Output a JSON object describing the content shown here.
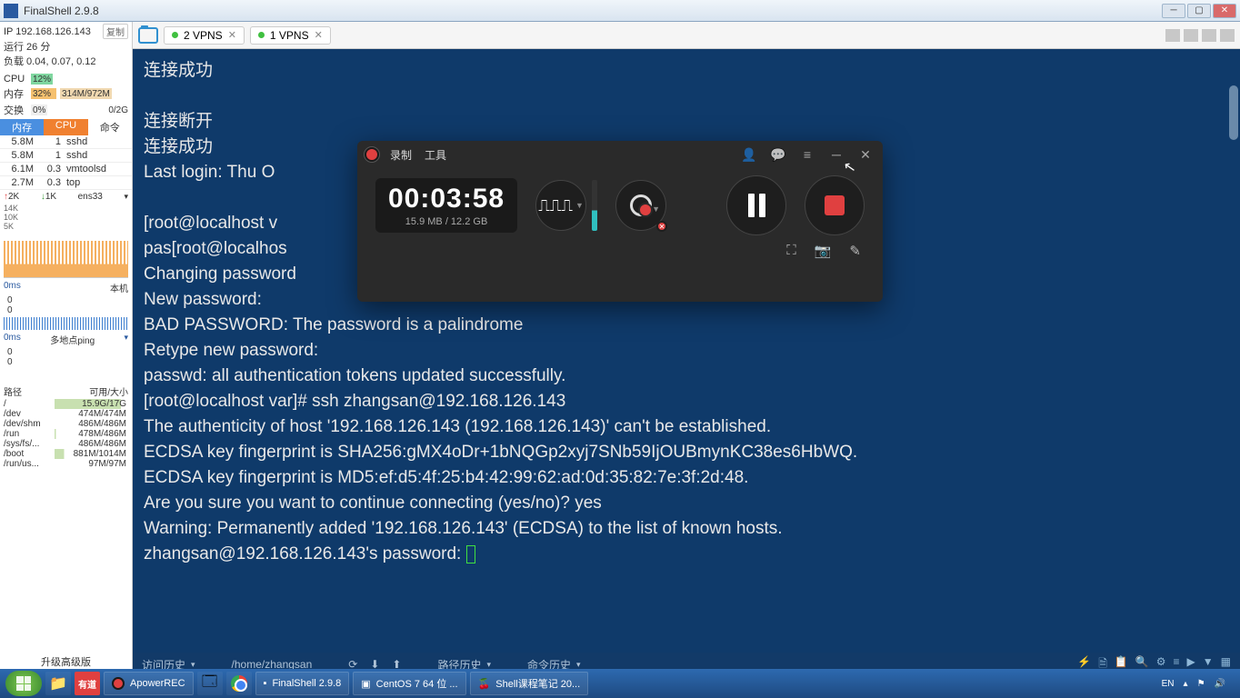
{
  "title": "FinalShell 2.9.8",
  "sidebar": {
    "ip": "IP 192.168.126.143",
    "copy": "复制",
    "uptime": "运行 26 分",
    "load": "负载 0.04, 0.07, 0.12",
    "cpu_lbl": "CPU",
    "cpu_pct": "12%",
    "mem_lbl": "内存",
    "mem_pct": "32%",
    "mem_txt": "314M/972M",
    "swap_lbl": "交换",
    "swap_pct": "0%",
    "swap_txt": "0/2G",
    "proc_hdr": {
      "a": "内存",
      "b": "CPU",
      "c": "命令"
    },
    "procs": [
      {
        "m": "5.8M",
        "c": "1",
        "n": "sshd"
      },
      {
        "m": "5.8M",
        "c": "1",
        "n": "sshd"
      },
      {
        "m": "6.1M",
        "c": "0.3",
        "n": "vmtoolsd"
      },
      {
        "m": "2.7M",
        "c": "0.3",
        "n": "top"
      }
    ],
    "net": {
      "up": "2K",
      "dn": "1K",
      "if": "ens33",
      "y1": "14K",
      "y2": "10K",
      "y3": "5K"
    },
    "lat1": {
      "l": "0ms",
      "r": "本机"
    },
    "lat2": {
      "l": "0ms",
      "r": "多地点ping"
    },
    "zeros": "0",
    "disk_hdr": {
      "a": "路径",
      "b": "可用/大小"
    },
    "disks": [
      {
        "p": "/",
        "s": "15.9G/17G",
        "u": 90
      },
      {
        "p": "/dev",
        "s": "474M/474M",
        "u": 0
      },
      {
        "p": "/dev/shm",
        "s": "486M/486M",
        "u": 0
      },
      {
        "p": "/run",
        "s": "478M/486M",
        "u": 2
      },
      {
        "p": "/sys/fs/...",
        "s": "486M/486M",
        "u": 0
      },
      {
        "p": "/boot",
        "s": "881M/1014M",
        "u": 13
      },
      {
        "p": "/run/us...",
        "s": "97M/97M",
        "u": 0
      }
    ],
    "upgrade": "升级高级版"
  },
  "tabs": [
    {
      "label": "2 VPNS"
    },
    {
      "label": "1 VPNS"
    }
  ],
  "terminal": [
    "连接成功",
    "",
    "连接断开",
    "连接成功",
    "Last login: Thu O",
    "",
    "[root@localhost v",
    "pas[root@localhos",
    "Changing password",
    "New password:",
    "BAD PASSWORD: The password is a palindrome",
    "Retype new password:",
    "passwd: all authentication tokens updated successfully.",
    "[root@localhost var]# ssh zhangsan@192.168.126.143",
    "The authenticity of host '192.168.126.143 (192.168.126.143)' can't be established.",
    "ECDSA key fingerprint is SHA256:gMX4oDr+1bNQGp2xyj7SNb59IjOUBmynKC38es6HbWQ.",
    "ECDSA key fingerprint is MD5:ef:d5:4f:25:b4:42:99:62:ad:0d:35:82:7e:3f:2d:48.",
    "Are you sure you want to continue connecting (yes/no)? yes",
    "Warning: Permanently added '192.168.126.143' (ECDSA) to the list of known hosts.",
    "zhangsan@192.168.126.143's password: "
  ],
  "bottom": {
    "hist": "访问历史",
    "path": "/home/zhangsan",
    "pathhist": "路径历史",
    "cmdhist": "命令历史"
  },
  "recorder": {
    "menu1": "录制",
    "menu2": "工具",
    "time": "00:03:58",
    "size": "15.9 MB / 12.2 GB"
  },
  "taskbar": {
    "apower": "ApowerREC",
    "finalshell": "FinalShell 2.9.8",
    "centos": "CentOS 7 64 位 ...",
    "shell": "Shell课程笔记 20...",
    "lang": "EN"
  }
}
